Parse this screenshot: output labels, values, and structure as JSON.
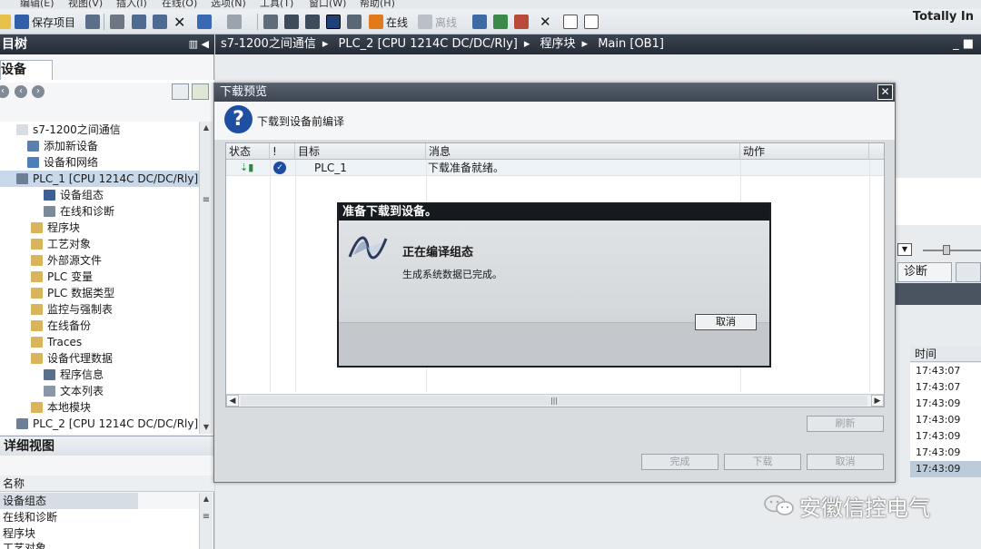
{
  "menubar": {
    "items": [
      "编辑(E)",
      "视图(V)",
      "插入(I)",
      "在线(O)",
      "选项(N)",
      "工具(T)",
      "窗口(W)",
      "帮助(H)"
    ]
  },
  "toolbar": {
    "save_project": "保存项目",
    "online": "在线",
    "offline": "离线",
    "brand": "Totally In"
  },
  "left_panel": {
    "title": "目树",
    "devices_tab": "设备",
    "tree": [
      {
        "label": "s7-1200之间通信",
        "icon": "project-icon"
      },
      {
        "label": "添加新设备",
        "icon": "add-device-icon"
      },
      {
        "label": "设备和网络",
        "icon": "network-icon"
      },
      {
        "label": "PLC_1 [CPU 1214C DC/DC/Rly]",
        "icon": "plc-icon"
      },
      {
        "label": "设备组态",
        "icon": "device-config-icon"
      },
      {
        "label": "在线和诊断",
        "icon": "diagnostics-icon"
      },
      {
        "label": "程序块",
        "icon": "folder-icon"
      },
      {
        "label": "工艺对象",
        "icon": "folder-icon"
      },
      {
        "label": "外部源文件",
        "icon": "folder-icon"
      },
      {
        "label": "PLC 变量",
        "icon": "folder-icon"
      },
      {
        "label": "PLC 数据类型",
        "icon": "folder-icon"
      },
      {
        "label": "监控与强制表",
        "icon": "folder-icon"
      },
      {
        "label": "在线备份",
        "icon": "folder-icon"
      },
      {
        "label": "Traces",
        "icon": "folder-icon"
      },
      {
        "label": "设备代理数据",
        "icon": "folder-icon"
      },
      {
        "label": "程序信息",
        "icon": "program-info-icon"
      },
      {
        "label": "文本列表",
        "icon": "text-list-icon"
      },
      {
        "label": "本地模块",
        "icon": "folder-icon"
      },
      {
        "label": "PLC_2 [CPU 1214C DC/DC/Rly]",
        "icon": "plc-icon"
      }
    ]
  },
  "detail_view": {
    "title": "详细视图",
    "column": "名称",
    "rows": [
      "设备组态",
      "在线和诊断",
      "程序块",
      "工艺对象"
    ]
  },
  "editor": {
    "breadcrumb": [
      "s7-1200之间通信",
      "PLC_2 [CPU 1214C DC/DC/Rly]",
      "程序块",
      "Main [OB1]"
    ]
  },
  "right_panel": {
    "diag_tab": "诊断",
    "time_header": "时间",
    "times": [
      "17:43:07",
      "17:43:07",
      "17:43:09",
      "17:43:09",
      "17:43:09",
      "17:43:09",
      "17:43:09"
    ]
  },
  "dialog": {
    "title": "下载预览",
    "subtitle": "下载到设备前编译",
    "columns": [
      "状态",
      "!",
      "目标",
      "消息",
      "动作"
    ],
    "row": {
      "target": "PLC_1",
      "message": "下载准备就绪。"
    },
    "refresh": "刷新",
    "finish": "完成",
    "download": "下载",
    "cancel": "取消"
  },
  "modal": {
    "title": "准备下载到设备。",
    "heading": "正在编译组态",
    "message": "生成系统数据已完成。",
    "cancel": "取消"
  },
  "watermark": {
    "text": "安徽信控电气"
  },
  "colors": {
    "title_bar": "#2f3742",
    "selection": "#c7d8ea",
    "accent_blue": "#1f4fa0"
  }
}
